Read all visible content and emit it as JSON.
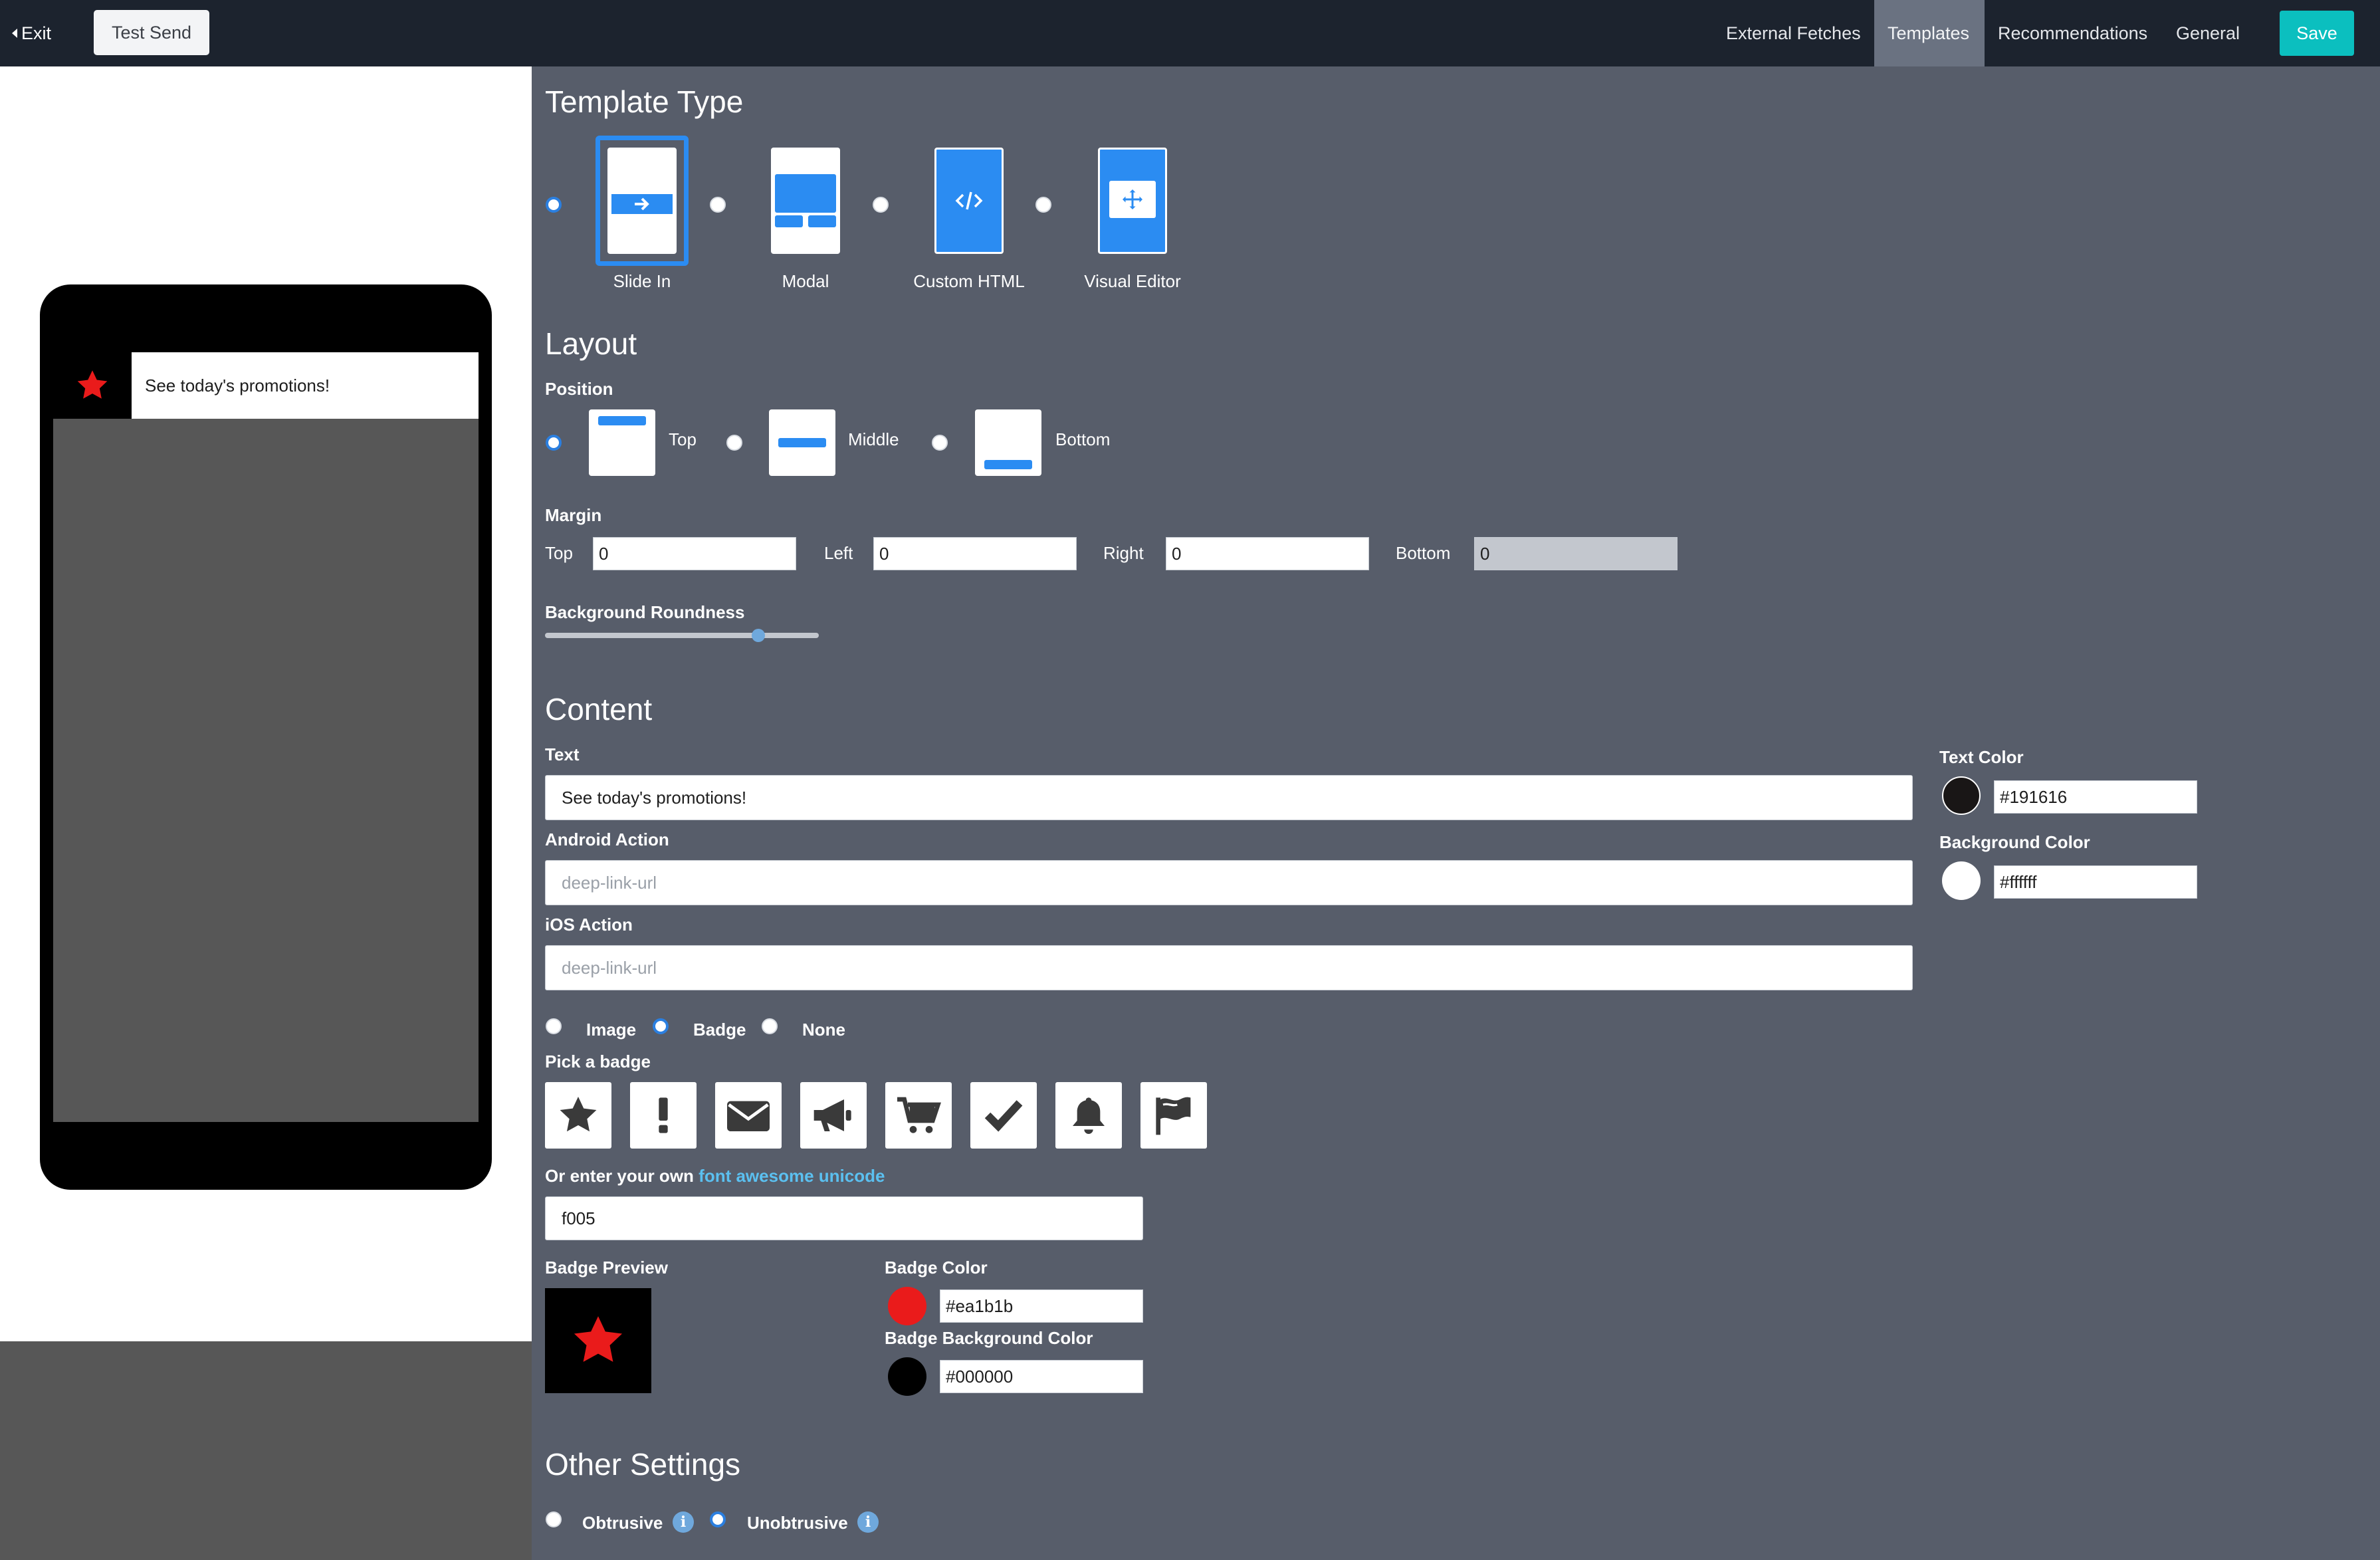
{
  "topbar": {
    "exit_label": "Exit",
    "test_send_label": "Test Send",
    "nav": [
      "External Fetches",
      "Templates",
      "Recommendations",
      "General"
    ],
    "active_nav": "Templates",
    "save_label": "Save"
  },
  "preview": {
    "message_text": "See today's promotions!",
    "badge_icon": "star-icon",
    "badge_color": "#ea1b1b",
    "badge_background": "#000000"
  },
  "template_type": {
    "heading": "Template Type",
    "options": [
      {
        "label": "Slide In",
        "icon": "arrow-right-icon",
        "selected": true
      },
      {
        "label": "Modal",
        "icon": "modal-layout-icon",
        "selected": false
      },
      {
        "label": "Custom HTML",
        "icon": "code-icon",
        "selected": false
      },
      {
        "label": "Visual Editor",
        "icon": "move-arrows-icon",
        "selected": false
      }
    ]
  },
  "layout": {
    "heading": "Layout",
    "position_label": "Position",
    "positions": [
      {
        "label": "Top",
        "selected": true
      },
      {
        "label": "Middle",
        "selected": false
      },
      {
        "label": "Bottom",
        "selected": false
      }
    ],
    "margin_label": "Margin",
    "margins": [
      {
        "label": "Top",
        "value": "0",
        "disabled": false
      },
      {
        "label": "Left",
        "value": "0",
        "disabled": false
      },
      {
        "label": "Right",
        "value": "0",
        "disabled": false
      },
      {
        "label": "Bottom",
        "value": "0",
        "disabled": true
      }
    ],
    "roundness_label": "Background Roundness",
    "roundness_value": 0.78
  },
  "content": {
    "heading": "Content",
    "text_label": "Text",
    "text_value": "See today's promotions!",
    "android_label": "Android Action",
    "android_placeholder": "deep-link-url",
    "ios_label": "iOS Action",
    "ios_placeholder": "deep-link-url",
    "text_color_label": "Text Color",
    "text_color_value": "#191616",
    "bg_color_label": "Background Color",
    "bg_color_value": "#ffffff",
    "media_options": [
      {
        "label": "Image",
        "selected": false
      },
      {
        "label": "Badge",
        "selected": true
      },
      {
        "label": "None",
        "selected": false
      }
    ],
    "pick_badge_label": "Pick a badge",
    "badges": [
      "star-icon",
      "exclamation-icon",
      "envelope-icon",
      "megaphone-icon",
      "cart-icon",
      "check-icon",
      "bell-icon",
      "flag-icon"
    ],
    "unicode_prefix": "Or enter your own",
    "unicode_link": "font awesome unicode",
    "unicode_value": "f005",
    "badge_preview_label": "Badge Preview",
    "badge_color_label": "Badge Color",
    "badge_color_value": "#ea1b1b",
    "badge_bg_color_label": "Badge Background Color",
    "badge_bg_color_value": "#000000"
  },
  "other": {
    "heading": "Other Settings",
    "options": [
      {
        "label": "Obtrusive",
        "selected": false
      },
      {
        "label": "Unobtrusive",
        "selected": true
      }
    ]
  }
}
